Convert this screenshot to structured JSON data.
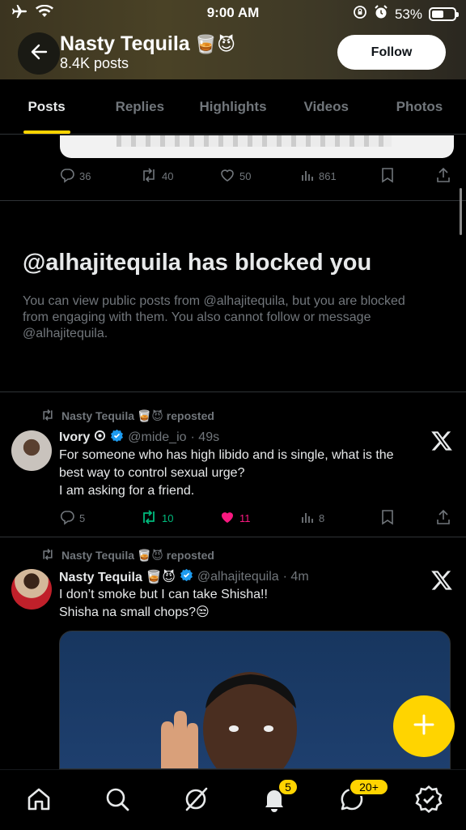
{
  "status_bar": {
    "time": "9:00 AM",
    "battery_percent_label": "53%",
    "battery_level": 0.53
  },
  "header": {
    "title": "Nasty Tequila",
    "title_emojis": "🥃😈",
    "posts_count": "8.4K posts",
    "follow_label": "Follow"
  },
  "tabs": [
    {
      "label": "Posts",
      "active": true
    },
    {
      "label": "Replies",
      "active": false
    },
    {
      "label": "Highlights",
      "active": false
    },
    {
      "label": "Videos",
      "active": false
    },
    {
      "label": "Photos",
      "active": false
    }
  ],
  "first_post_actions": {
    "replies": "36",
    "reposts": "40",
    "likes": "50",
    "views": "861"
  },
  "blocked_notice": {
    "title": "@alhajitequila has blocked you",
    "description": "You can view public posts from @alhajitequila, but you are blocked from engaging with them. You also cannot follow or message @alhajitequila."
  },
  "posts": [
    {
      "repost_label": "Nasty Tequila 🥃😈 reposted",
      "name": "Ivory",
      "handle": "@mide_io",
      "time": "· 49s",
      "text_lines": [
        "For someone who has high libido and is single, what is the",
        "best way to control sexual urge?",
        "I am asking for a friend."
      ],
      "replies": "5",
      "reposts": "10",
      "likes": "11",
      "views": "8"
    },
    {
      "repost_label": "Nasty Tequila 🥃😈 reposted",
      "name": "Nasty Tequila 🥃😈",
      "handle": "@alhajitequila",
      "time": "· 4m",
      "text_lines": [
        "I don’t smoke but I can take Shisha!!",
        "Shisha na small chops?😒"
      ]
    }
  ],
  "bottom_nav": {
    "notifications_badge": "5",
    "messages_badge": "20+"
  },
  "colors": {
    "accent": "#ffd400",
    "like": "#f91880",
    "repost": "#00ba7c",
    "muted": "#71767b",
    "verified": "#1d9bf0"
  }
}
